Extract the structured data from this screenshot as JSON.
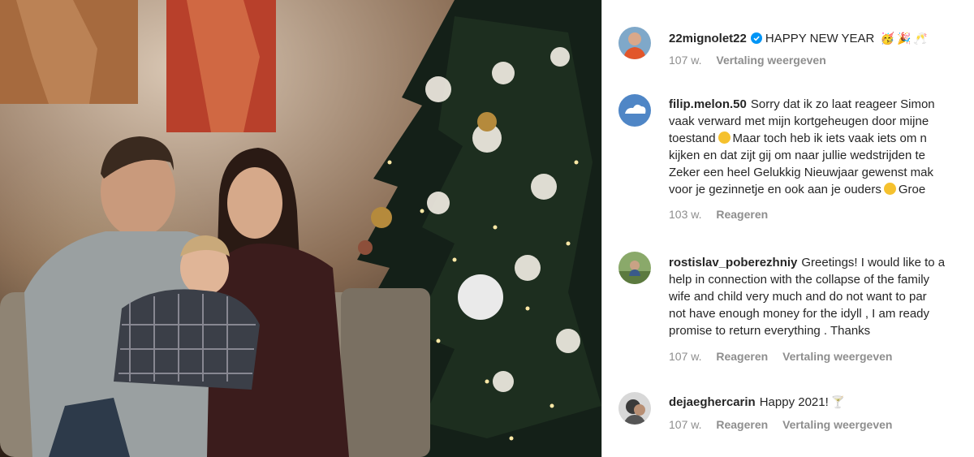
{
  "post": {
    "username": "22mignolet22",
    "caption": "HAPPY NEW YEAR",
    "caption_emojis": [
      "🥳",
      "🎉",
      "🥂"
    ],
    "time": "107 w.",
    "translate": "Vertaling weergeven"
  },
  "comments": [
    {
      "username": "filip.melon.50",
      "lines": [
        "Sorry dat ik zo laat reageer Simon",
        "vaak verward met mijn kortgeheugen door mijne",
        "toestand",
        "Maar toch heb ik iets vaak iets om n",
        "kijken en dat zijt gij om naar jullie wedstrijden te",
        "Zeker een heel Gelukkig Nieuwjaar gewenst mak",
        "voor je gezinnetje en ook aan je ouders",
        "Groe"
      ],
      "time": "103 w.",
      "reply": "Reageren"
    },
    {
      "username": "rostislav_poberezhniy",
      "lines": [
        "Greetings! I would like to a",
        "help in connection with the collapse of the family",
        "wife and child very much and do not want to par",
        "not have enough money for the idyll , I am ready",
        "promise to return everything . Thanks"
      ],
      "time": "107 w.",
      "reply": "Reageren",
      "translate": "Vertaling weergeven"
    },
    {
      "username": "dejaeghercarin",
      "text": "Happy 2021!",
      "emoji": "🍸",
      "time": "107 w.",
      "reply": "Reageren",
      "translate": "Vertaling weergeven"
    }
  ],
  "colors": {
    "text": "#262626",
    "muted": "#8e8e8e",
    "verified": "#0095f6",
    "divider": "#dbdbdb"
  }
}
